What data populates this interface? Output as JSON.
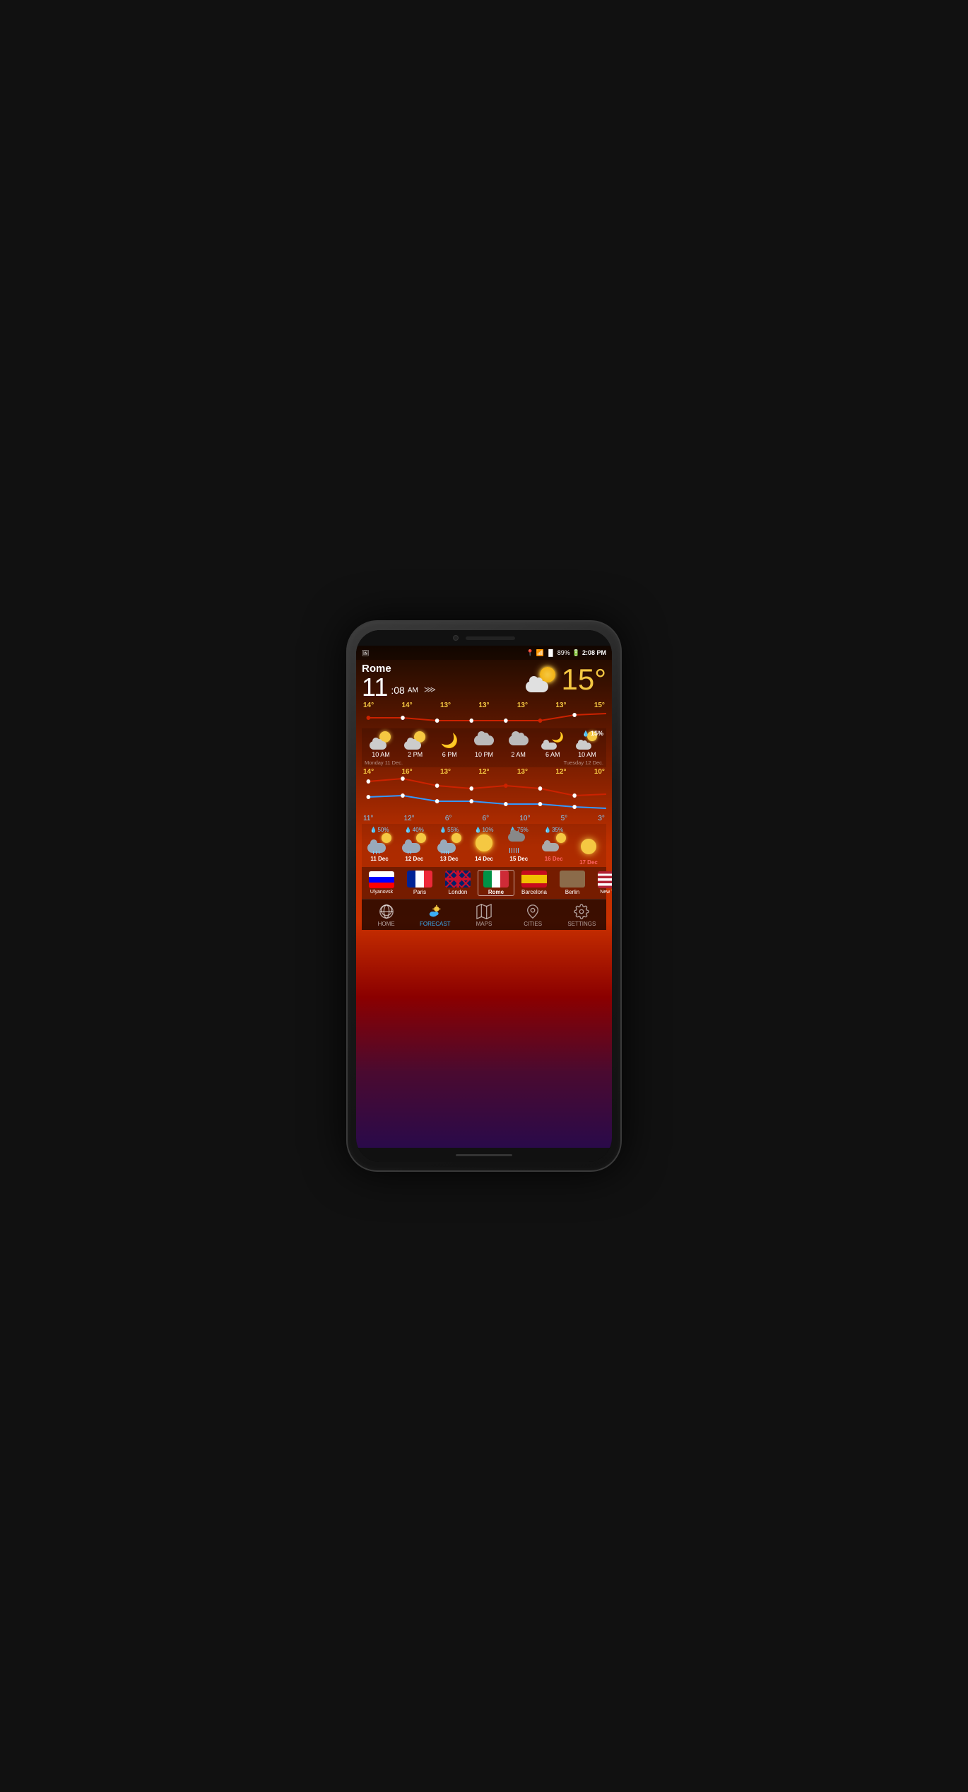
{
  "phone": {
    "status_bar": {
      "location_icon": "📍",
      "wifi_icon": "wifi",
      "signal_icon": "signal",
      "battery": "89%",
      "time": "2:08 PM"
    },
    "weather": {
      "city": "Rome",
      "time": "11",
      "time_minutes": ":08",
      "time_ampm": "AM",
      "current_temp": "15°",
      "current_condition": "partly cloudy",
      "temp_graph_top": "15°",
      "hourly": [
        {
          "time": "10 AM",
          "icon": "sun-cloud",
          "temp_high": "14°",
          "temp_low": "11°"
        },
        {
          "time": "2 PM",
          "icon": "sun-cloud",
          "temp_high": "16°",
          "temp_low": "12°"
        },
        {
          "time": "6 PM",
          "icon": "moon",
          "temp_high": "13°",
          "temp_low": "6°"
        },
        {
          "time": "10 PM",
          "icon": "cloud",
          "temp_high": "12°",
          "temp_low": "6°"
        },
        {
          "time": "2 AM",
          "icon": "cloud",
          "temp_high": "13°",
          "temp_low": "10°"
        },
        {
          "time": "6 AM",
          "icon": "moon-cloud",
          "temp_high": "12°",
          "temp_low": "5°"
        },
        {
          "time": "10 AM",
          "icon": "sun-cloud-small",
          "temp_high": "10°",
          "temp_low": "3°"
        }
      ],
      "day_monday": "Monday 11 Dec.",
      "day_tuesday": "Tuesday 12 Dec.",
      "hourly_temp_row1": [
        "14°",
        "14°",
        "13°",
        "13°",
        "13°",
        "13°",
        "15°"
      ],
      "rain_chance_label": "15%",
      "daily": [
        {
          "date": "11 Dec",
          "percent": "50%",
          "icon": "rain-sun",
          "weekend": false
        },
        {
          "date": "12 Dec",
          "percent": "40%",
          "icon": "rain-sun",
          "weekend": false
        },
        {
          "date": "13 Dec",
          "percent": "55%",
          "icon": "rain-sun",
          "weekend": false
        },
        {
          "date": "14 Dec",
          "percent": "10%",
          "icon": "sun",
          "weekend": false
        },
        {
          "date": "15 Dec",
          "percent": "75%",
          "icon": "rain-heavy",
          "weekend": false
        },
        {
          "date": "16 Dec",
          "percent": "35%",
          "icon": "cloud-sun",
          "weekend": true
        },
        {
          "date": "17 Dec",
          "percent": "",
          "icon": "sun",
          "weekend": true
        }
      ]
    },
    "cities": [
      {
        "name": "Ulyanovsk",
        "flag": "russia"
      },
      {
        "name": "Paris",
        "flag": "france"
      },
      {
        "name": "London",
        "flag": "uk"
      },
      {
        "name": "Rome",
        "flag": "italy",
        "active": true
      },
      {
        "name": "Barcelona",
        "flag": "spain"
      },
      {
        "name": "Berlin",
        "flag": "brown"
      },
      {
        "name": "New York",
        "flag": "usa"
      }
    ],
    "nav": [
      {
        "id": "home",
        "label": "HOME",
        "active": false
      },
      {
        "id": "forecast",
        "label": "FORECAST",
        "active": true
      },
      {
        "id": "maps",
        "label": "MAPS",
        "active": false
      },
      {
        "id": "cities",
        "label": "CITIES",
        "active": false
      },
      {
        "id": "settings",
        "label": "SETTINGS",
        "active": false
      }
    ]
  }
}
